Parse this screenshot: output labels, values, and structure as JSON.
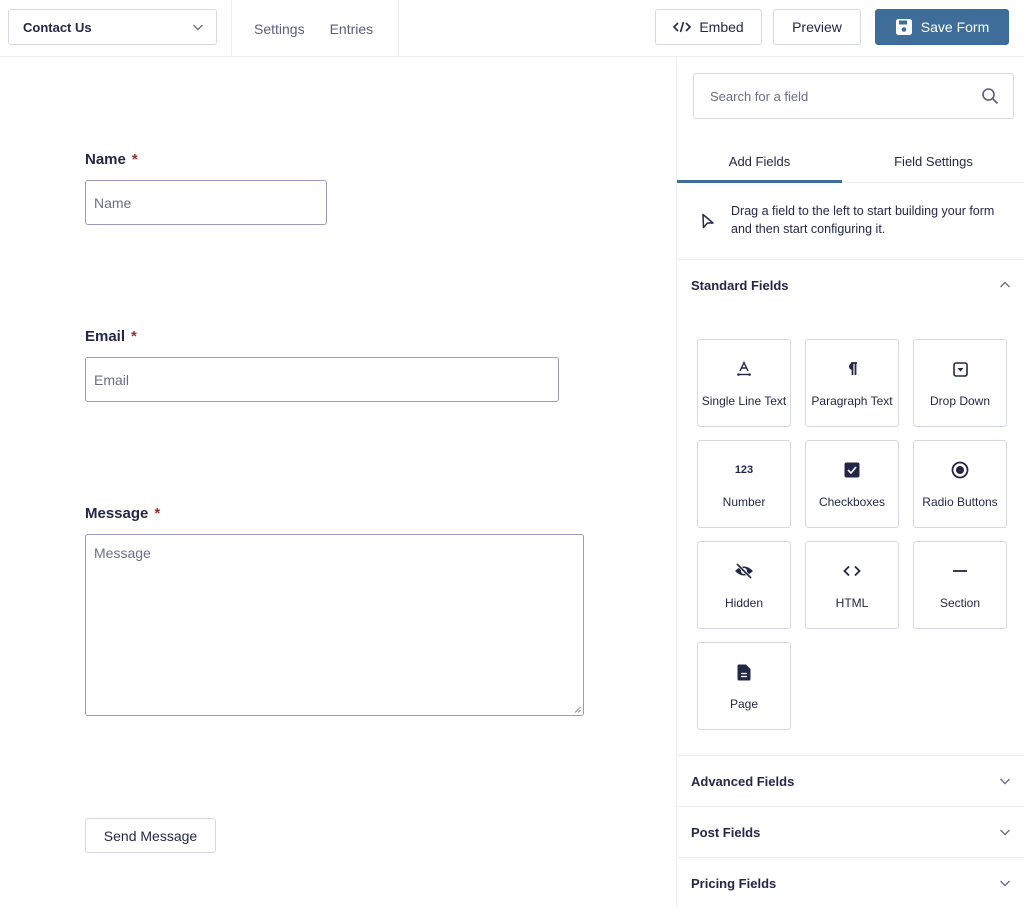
{
  "topbar": {
    "form_selector": "Contact Us",
    "nav": [
      {
        "label": "Settings"
      },
      {
        "label": "Entries"
      }
    ],
    "embed_label": "Embed",
    "preview_label": "Preview",
    "save_label": "Save Form",
    "accent_color": "#3e6d9a"
  },
  "form": {
    "fields": [
      {
        "label": "Name",
        "required_marker": "*",
        "placeholder": "Name",
        "type": "text"
      },
      {
        "label": "Email",
        "required_marker": "*",
        "placeholder": "Email",
        "type": "email"
      },
      {
        "label": "Message",
        "required_marker": "*",
        "placeholder": "Message",
        "type": "textarea"
      }
    ],
    "submit_label": "Send Message"
  },
  "sidebar": {
    "search_placeholder": "Search for a field",
    "tabs": [
      {
        "label": "Add Fields",
        "active": true
      },
      {
        "label": "Field Settings",
        "active": false
      }
    ],
    "hint": "Drag a field to the left to start building your form and then start configuring it.",
    "sections": [
      {
        "title": "Standard Fields",
        "expanded": true
      },
      {
        "title": "Advanced Fields",
        "expanded": false
      },
      {
        "title": "Post Fields",
        "expanded": false
      },
      {
        "title": "Pricing Fields",
        "expanded": false
      }
    ],
    "standard_fields": [
      {
        "label": "Single Line Text",
        "icon": "text-line-icon"
      },
      {
        "label": "Paragraph Text",
        "icon": "paragraph-icon"
      },
      {
        "label": "Drop Down",
        "icon": "dropdown-icon"
      },
      {
        "label": "Number",
        "icon": "number-icon",
        "glyph": "123"
      },
      {
        "label": "Checkboxes",
        "icon": "checkbox-icon"
      },
      {
        "label": "Radio Buttons",
        "icon": "radio-icon"
      },
      {
        "label": "Hidden",
        "icon": "eye-slash-icon"
      },
      {
        "label": "HTML",
        "icon": "code-icon"
      },
      {
        "label": "Section",
        "icon": "section-icon"
      },
      {
        "label": "Page",
        "icon": "page-icon"
      }
    ]
  }
}
